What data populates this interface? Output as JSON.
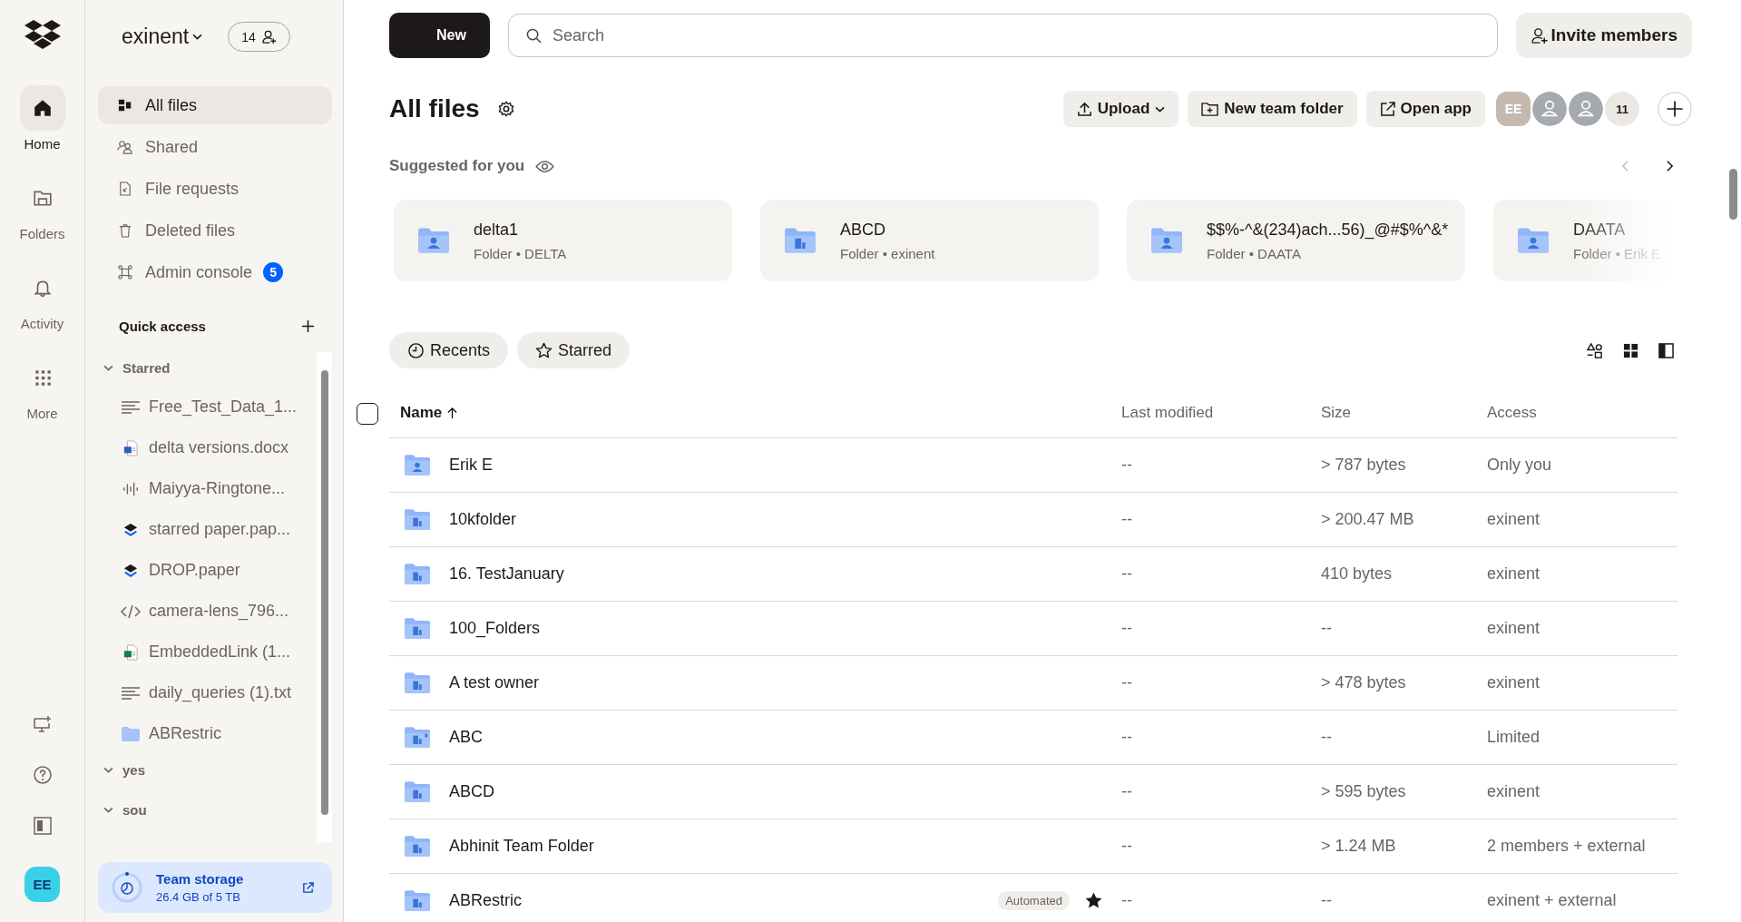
{
  "rail": {
    "items": [
      {
        "label": "Home",
        "selected": true
      },
      {
        "label": "Folders",
        "selected": false
      },
      {
        "label": "Activity",
        "selected": false
      },
      {
        "label": "More",
        "selected": false
      }
    ],
    "avatar": "EE"
  },
  "sidebar": {
    "team": "exinent",
    "member_count": "14",
    "nav": [
      {
        "label": "All files",
        "selected": true
      },
      {
        "label": "Shared",
        "selected": false
      },
      {
        "label": "File requests",
        "selected": false
      },
      {
        "label": "Deleted files",
        "selected": false
      },
      {
        "label": "Admin console",
        "selected": false,
        "badge": "5"
      }
    ],
    "quick_access": {
      "title": "Quick access",
      "sections": [
        {
          "label": "Starred",
          "items": [
            {
              "label": "Free_Test_Data_1...",
              "kind": "text"
            },
            {
              "label": "delta versions.docx",
              "kind": "word"
            },
            {
              "label": "Maiyya-Ringtone...",
              "kind": "audio"
            },
            {
              "label": "starred paper.pap...",
              "kind": "paper"
            },
            {
              "label": "DROP.paper",
              "kind": "paper"
            },
            {
              "label": "camera-lens_796...",
              "kind": "code"
            },
            {
              "label": "EmbeddedLink (1...",
              "kind": "excel"
            },
            {
              "label": "daily_queries (1).txt",
              "kind": "text"
            },
            {
              "label": "ABRestric",
              "kind": "folder"
            }
          ]
        },
        {
          "label": "yes"
        },
        {
          "label": "sou"
        }
      ]
    },
    "storage": {
      "title": "Team storage",
      "usage": "26.4 GB of 5 TB"
    }
  },
  "topbar": {
    "new_button": "New",
    "search": {
      "placeholder": "Search"
    },
    "invite_button": "Invite members"
  },
  "header": {
    "title": "All files",
    "buttons": [
      {
        "label": "Upload",
        "kind": "upload"
      },
      {
        "label": "New team folder",
        "kind": "folder"
      },
      {
        "label": "Open app",
        "kind": "open"
      }
    ],
    "avatars": [
      {
        "kind": "initials",
        "label": "EE"
      },
      {
        "kind": "person"
      },
      {
        "kind": "person"
      },
      {
        "kind": "count",
        "label": "11"
      }
    ]
  },
  "suggested": {
    "title": "Suggested for you",
    "cards": [
      {
        "name": "delta1",
        "detail": "Folder • DELTA",
        "kind": "personal"
      },
      {
        "name": "ABCD",
        "detail": "Folder • exinent",
        "kind": "team"
      },
      {
        "name": "$$%-^&(234)ach...56)_@#$%^&*",
        "detail": "Folder • DAATA",
        "kind": "personal"
      },
      {
        "name": "DAATA",
        "detail": "Folder • Erik E",
        "kind": "personal"
      }
    ]
  },
  "filters": [
    {
      "label": "Recents",
      "kind": "clock"
    },
    {
      "label": "Starred",
      "kind": "star"
    }
  ],
  "table": {
    "select_all": {
      "checked": false
    },
    "columns": [
      "Name",
      "Last modified",
      "Size",
      "Access"
    ],
    "rows": [
      {
        "name": "Erik E",
        "kind": "personal",
        "modified": "--",
        "size": "> 787 bytes",
        "access": "Only you",
        "starred": false
      },
      {
        "name": "10kfolder",
        "kind": "team",
        "modified": "--",
        "size": "> 200.47 MB",
        "access": "exinent",
        "starred": false
      },
      {
        "name": "16. TestJanuary",
        "kind": "team",
        "modified": "--",
        "size": "410 bytes",
        "access": "exinent",
        "starred": false
      },
      {
        "name": "100_Folders",
        "kind": "team",
        "modified": "--",
        "size": "--",
        "access": "exinent",
        "starred": false
      },
      {
        "name": "A test owner",
        "kind": "team",
        "modified": "--",
        "size": "> 478 bytes",
        "access": "exinent",
        "starred": false
      },
      {
        "name": "ABC",
        "kind": "team-limited",
        "modified": "--",
        "size": "--",
        "access": "Limited",
        "starred": false
      },
      {
        "name": "ABCD",
        "kind": "team",
        "modified": "--",
        "size": "> 595 bytes",
        "access": "exinent",
        "starred": false
      },
      {
        "name": "Abhinit Team Folder",
        "kind": "team",
        "modified": "--",
        "size": "> 1.24 MB",
        "access": "2 members + external",
        "starred": false
      },
      {
        "name": "ABRestric",
        "kind": "team",
        "modified": "--",
        "size": "--",
        "access": "exinent + external",
        "starred": true,
        "badge": "Automated"
      }
    ]
  }
}
